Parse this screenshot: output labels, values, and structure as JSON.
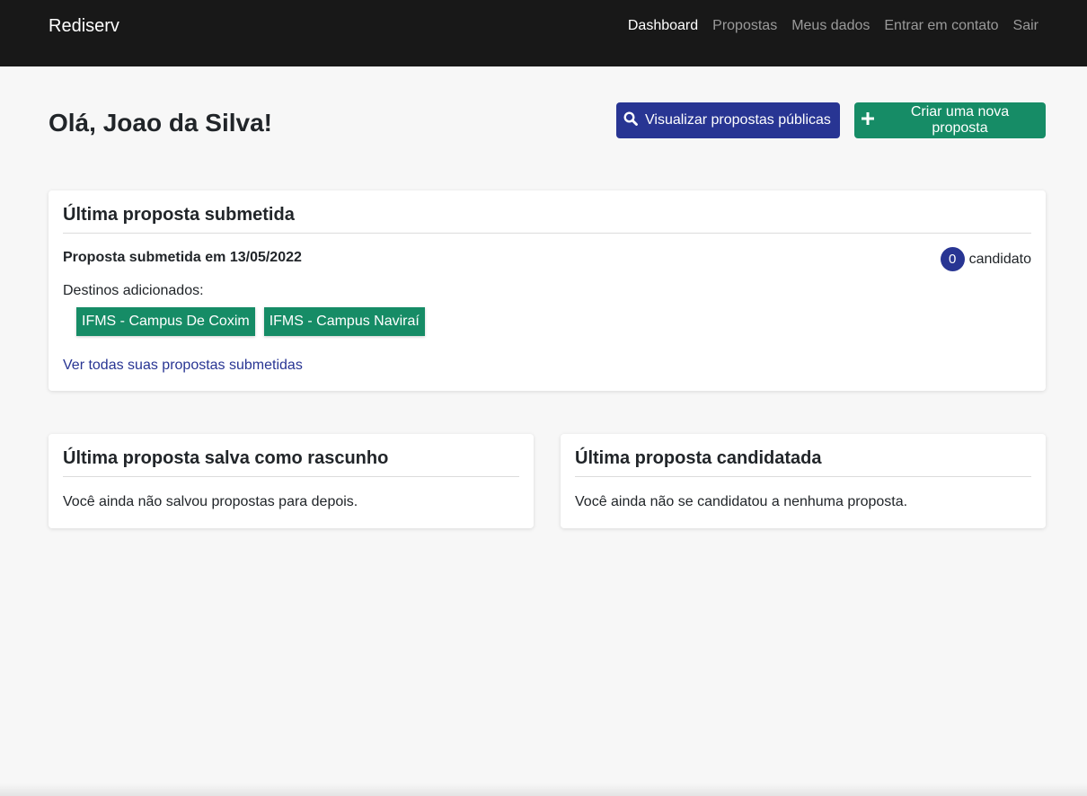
{
  "navbar": {
    "brand": "Rediserv",
    "items": [
      {
        "label": "Dashboard",
        "active": true
      },
      {
        "label": "Propostas",
        "active": false
      },
      {
        "label": "Meus dados",
        "active": false
      },
      {
        "label": "Entrar em contato",
        "active": false
      },
      {
        "label": "Sair",
        "active": false
      }
    ]
  },
  "header": {
    "greeting": "Olá, Joao da Silva!",
    "view_public_button": {
      "label": "Visualizar propostas públicas",
      "icon": "search-icon"
    },
    "create_button": {
      "label": "Criar uma nova proposta",
      "icon": "plus-icon"
    }
  },
  "last_submitted": {
    "title": "Última proposta submetida",
    "submitted_text": "Proposta submetida em 13/05/2022",
    "candidate_count": "0",
    "candidate_label": "candidato",
    "destinations_label": "Destinos adicionados:",
    "destinations": [
      "IFMS - Campus De Coxim",
      "IFMS - Campus Naviraí"
    ],
    "view_all_link": "Ver todas suas propostas submetidas"
  },
  "last_draft": {
    "title": "Última proposta salva como rascunho",
    "empty_text": "Você ainda não salvou propostas para depois."
  },
  "last_applied": {
    "title": "Última proposta candidatada",
    "empty_text": "Você ainda não se candidatou a nenhuma proposta."
  },
  "colors": {
    "navbar_bg": "#181818",
    "primary_blue": "#283593",
    "success_green": "#168c66",
    "page_bg": "#f7f7f7"
  }
}
